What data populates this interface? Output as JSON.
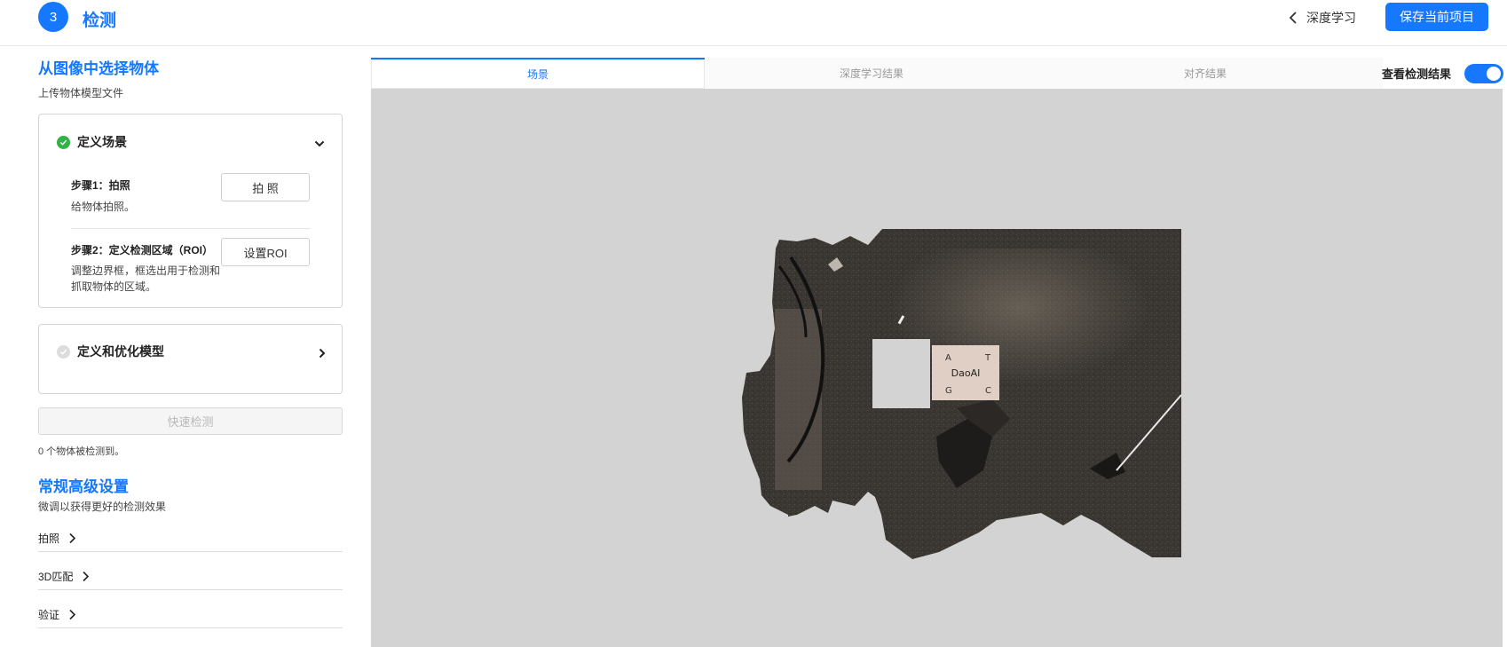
{
  "header": {
    "step_number": "3",
    "title": "检测",
    "back_label": "深度学习",
    "save_label": "保存当前项目"
  },
  "left": {
    "select_title": "从图像中选择物体",
    "select_subtitle": "上传物体模型文件",
    "scene_card": {
      "title": "定义场景",
      "step1_title": "步骤1：拍照",
      "step1_desc": "给物体拍照。",
      "step1_button": "拍 照",
      "step2_title": "步骤2：定义检测区域（ROI）",
      "step2_desc": "调整边界框，框选出用于检测和抓取物体的区域。",
      "step2_button": "设置ROI"
    },
    "model_card": {
      "title": "定义和优化模型"
    },
    "quick_detect_label": "快速检测",
    "detect_count_text": "0 个物体被检测到。",
    "advanced_title": "常规高级设置",
    "advanced_subtitle": "微调以获得更好的检测效果",
    "advanced_items": [
      {
        "label": "拍照"
      },
      {
        "label": "3D匹配"
      },
      {
        "label": "验证"
      }
    ]
  },
  "tabs": [
    {
      "label": "场景",
      "active": true
    },
    {
      "label": "深度学习结果",
      "active": false
    },
    {
      "label": "对齐结果",
      "active": false
    }
  ],
  "toggle": {
    "label": "查看检测结果",
    "on": true
  },
  "scene": {
    "box_text": "DaoAI",
    "box_corners": [
      "A",
      "T",
      "G",
      "C"
    ]
  },
  "colors": {
    "accent": "#1677ff",
    "success": "#2fb344",
    "viewport_bg": "#d3d3d3",
    "point_cloud": "#3a3632"
  }
}
